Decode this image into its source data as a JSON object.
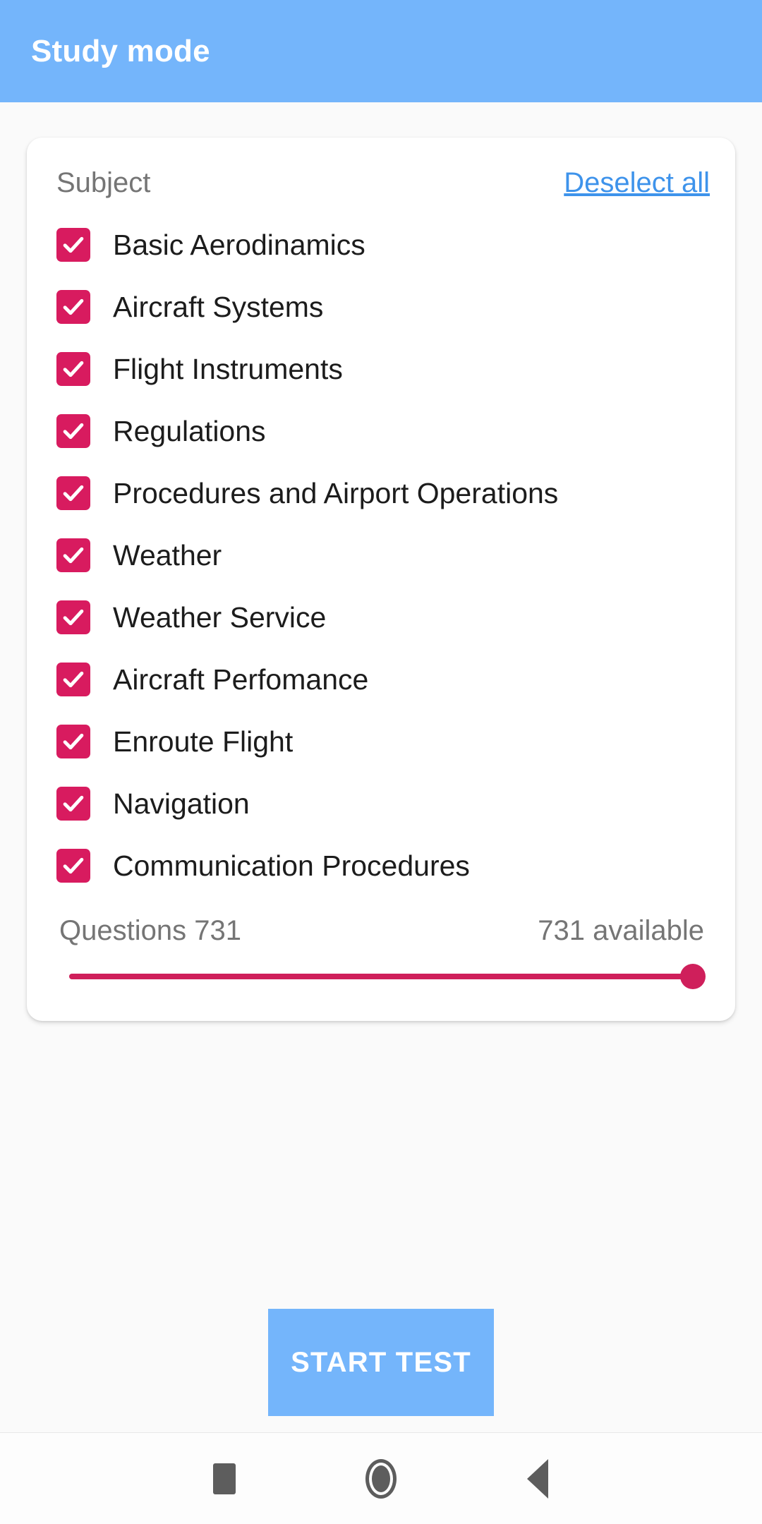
{
  "appbar": {
    "title": "Study mode",
    "background_color": "#74b5fb"
  },
  "card": {
    "header": {
      "label": "Subject",
      "deselect_all": "Deselect all",
      "link_color": "#3e93eb"
    },
    "checkbox_color": "#d81b5f",
    "subjects": [
      {
        "label": "Basic Aerodinamics",
        "checked": true
      },
      {
        "label": "Aircraft Systems",
        "checked": true
      },
      {
        "label": "Flight Instruments",
        "checked": true
      },
      {
        "label": "Regulations",
        "checked": true
      },
      {
        "label": "Procedures and Airport Operations",
        "checked": true
      },
      {
        "label": "Weather",
        "checked": true
      },
      {
        "label": "Weather Service",
        "checked": true
      },
      {
        "label": "Aircraft Perfomance",
        "checked": true
      },
      {
        "label": "Enroute Flight",
        "checked": true
      },
      {
        "label": "Navigation",
        "checked": true
      },
      {
        "label": "Communication Procedures",
        "checked": true
      }
    ],
    "questions": {
      "count_label": "Questions 731",
      "available_label": "731 available",
      "slider_value": 731,
      "slider_max": 731,
      "slider_color": "#cf1f5b"
    }
  },
  "start_button": {
    "label": "START TEST",
    "background_color": "#74b5fb"
  },
  "navbar": {
    "recents_icon": "square-icon",
    "home_icon": "circle-icon",
    "back_icon": "triangle-left-icon"
  }
}
